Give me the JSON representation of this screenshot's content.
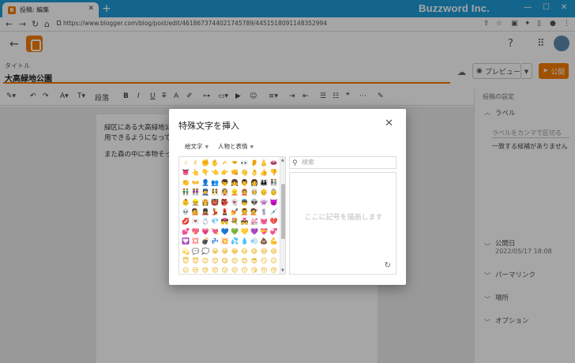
{
  "browser": {
    "tab_title": "投稿: 編集",
    "tab_close": "✕",
    "new_tab": "+",
    "brand": "Buzzword Inc.",
    "url": "https://www.blogger.com/blog/post/edit/4618673744021745789/4451518091148352994",
    "window_buttons": [
      "―",
      "☐",
      "✕"
    ]
  },
  "app": {
    "title_label": "タイトル",
    "post_title": "大高緑地公園",
    "preview_label": "プレビュー",
    "publish_label": "公開",
    "toolbar": {
      "paragraph": "段落",
      "more": "⋯"
    },
    "body_lines": [
      "緑区にある大高緑地公",
      "用できるようになってい",
      "また森の中に本物そっく"
    ],
    "sidebar": {
      "header": "投稿の設定",
      "labels_title": "ラベル",
      "labels_placeholder": "ラベルをカンマで区切る",
      "labels_nomatch": "一致する候補がありません",
      "published_title": "公開日",
      "published_value": "2022/05/17 18:08",
      "permalink": "パーマリンク",
      "location": "場所",
      "options": "オプション"
    }
  },
  "dialog": {
    "title": "特殊文字を挿入",
    "close": "✕",
    "category_dropdown": "絵文字",
    "subcategory_dropdown": "人物と表情",
    "search_placeholder": "検索",
    "draw_placeholder": "ここに記号を描画します",
    "emojis": [
      "☝",
      "✌",
      "✊",
      "✋",
      "✍",
      "❤",
      "👀",
      "👂",
      "👃",
      "👄",
      "👅",
      "👆",
      "👇",
      "👈",
      "👉",
      "👊",
      "👋",
      "👌",
      "👍",
      "👎",
      "👏",
      "👐",
      "👤",
      "👥",
      "👦",
      "👧",
      "👨",
      "👩",
      "👪",
      "👫",
      "👬",
      "👭",
      "👮",
      "👯",
      "👰",
      "👱",
      "👲",
      "👳",
      "👴",
      "👵",
      "👶",
      "👷",
      "👸",
      "👹",
      "👺",
      "👻",
      "👼",
      "👽",
      "👾",
      "👿",
      "💀",
      "💁",
      "💂",
      "💃",
      "💄",
      "💅",
      "💆",
      "💇",
      "💈",
      "💉",
      "💋",
      "💌",
      "💍",
      "💎",
      "💏",
      "💐",
      "💑",
      "💒",
      "💓",
      "💔",
      "💕",
      "💖",
      "💗",
      "💘",
      "💙",
      "💚",
      "💛",
      "💜",
      "💝",
      "💞",
      "💟",
      "💢",
      "💣",
      "💤",
      "💥",
      "💦",
      "💧",
      "💨",
      "💩",
      "💪",
      "💫",
      "💬",
      "💭",
      "😀",
      "😁",
      "😂",
      "😃",
      "😄",
      "😅",
      "😆",
      "😇",
      "😈",
      "😉",
      "😊",
      "😋",
      "😌",
      "😍",
      "😎",
      "😏",
      "😐",
      "😑",
      "😒",
      "😓",
      "😔",
      "😕",
      "😖",
      "😗",
      "😘",
      "😙",
      "😚",
      "😛",
      "😜",
      "😝",
      "😞",
      "😟",
      "😠",
      "😡",
      "😢",
      "😣",
      "😤"
    ]
  }
}
